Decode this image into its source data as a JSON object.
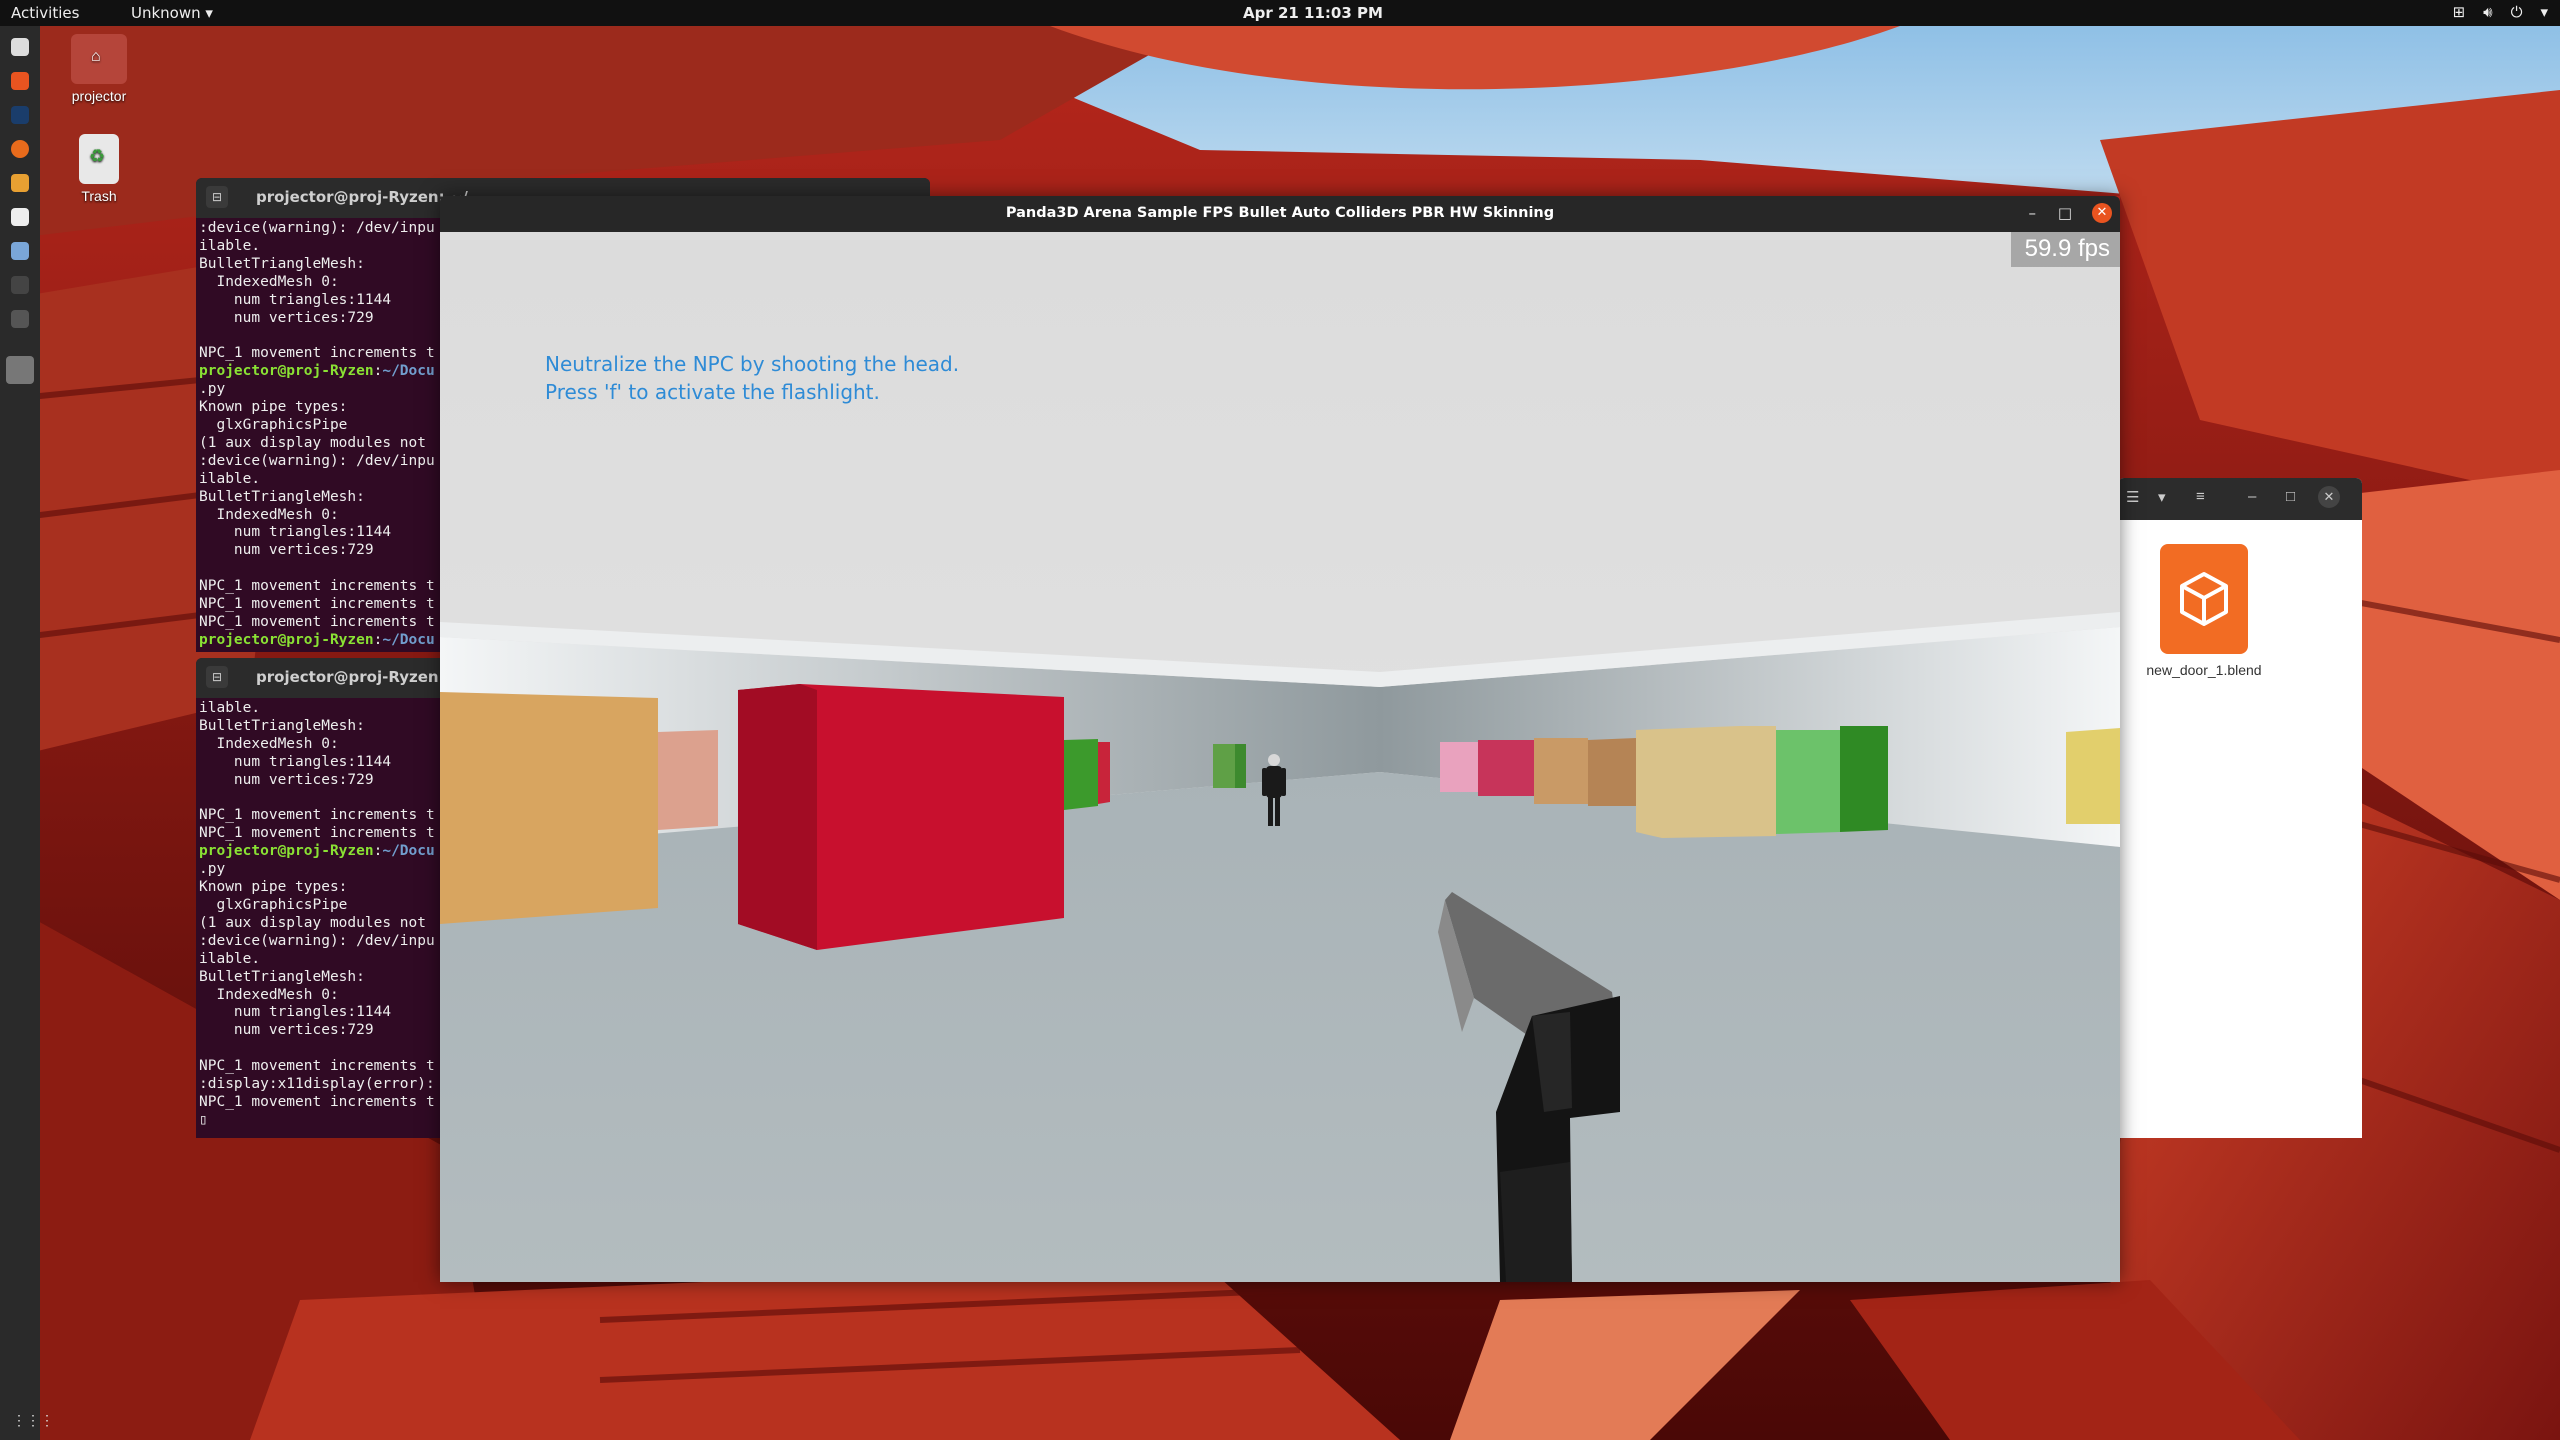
{
  "topbar": {
    "activities": "Activities",
    "app_menu": "Unknown ▾",
    "clock": "Apr 21  11:03 PM",
    "tray_icons": [
      "network-icon",
      "volume-icon",
      "power-icon",
      "chevron-down-icon"
    ]
  },
  "desktop": {
    "icons": [
      {
        "label": "projector",
        "icon": "home-folder-icon"
      },
      {
        "label": "Trash",
        "icon": "trash-icon"
      }
    ]
  },
  "terminal_top": {
    "title": "projector@proj-Ryzen: ~/",
    "lines": [
      ":device(warning): /dev/inpu",
      "ilable.",
      "BulletTriangleMesh:",
      "  IndexedMesh 0:",
      "    num triangles:1144",
      "    num vertices:729",
      "",
      "NPC_1 movement increments t",
      "§projector@proj-Ryzen§:~/Docu",
      ".py",
      "Known pipe types:",
      "  glxGraphicsPipe",
      "(1 aux display modules not",
      ":device(warning): /dev/inpu",
      "ilable.",
      "BulletTriangleMesh:",
      "  IndexedMesh 0:",
      "    num triangles:1144",
      "    num vertices:729",
      "",
      "NPC_1 movement increments t",
      "NPC_1 movement increments t",
      "NPC_1 movement increments t",
      "§projector@proj-Ryzen§:~/Docu"
    ]
  },
  "terminal_bottom": {
    "title": "projector@proj-Ryzen: ~/",
    "lines": [
      "ilable.",
      "BulletTriangleMesh:",
      "  IndexedMesh 0:",
      "    num triangles:1144",
      "    num vertices:729",
      "",
      "NPC_1 movement increments t",
      "NPC_1 movement increments t",
      "§projector@proj-Ryzen§:~/Docu",
      ".py",
      "Known pipe types:",
      "  glxGraphicsPipe",
      "(1 aux display modules not",
      ":device(warning): /dev/inpu",
      "ilable.",
      "BulletTriangleMesh:",
      "  IndexedMesh 0:",
      "    num triangles:1144",
      "    num vertices:729",
      "",
      "NPC_1 movement increments t",
      ":display:x11display(error):",
      "NPC_1 movement increments t",
      "▯"
    ]
  },
  "game": {
    "title": "Panda3D Arena Sample FPS Bullet Auto Colliders PBR HW Skinning",
    "fps": "59.9 fps",
    "hint1": "Neutralize the NPC by shooting the head.",
    "hint2": "Press 'f' to activate the flashlight."
  },
  "file_manager": {
    "file_name": "new_door_1.blend",
    "file_icon": "blender-file-icon"
  }
}
